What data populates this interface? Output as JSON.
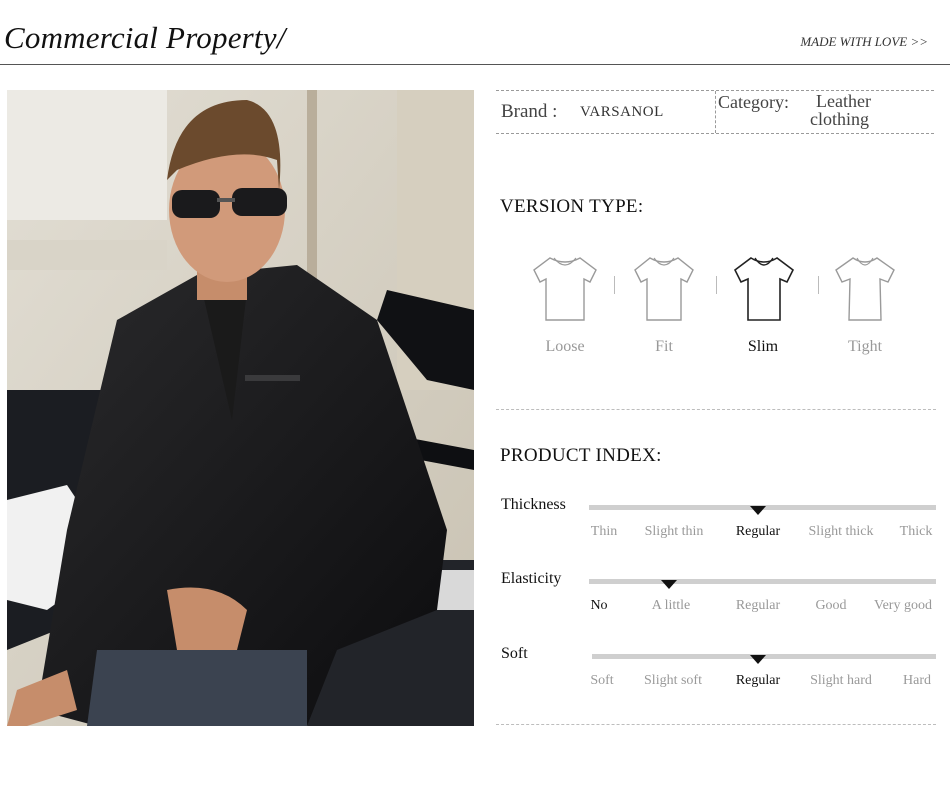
{
  "header": {
    "title": "Commercial Property/",
    "tagline": "MADE WITH LOVE >>"
  },
  "photo": {
    "alt": "model-photo"
  },
  "info": {
    "brand_label": "Brand :",
    "brand_value": "VARSANOL",
    "category_label": "Category:",
    "category_value_line1": "Leather",
    "category_value_line2": "clothing"
  },
  "version": {
    "heading": "VERSION TYPE:",
    "options": [
      {
        "label": "Loose",
        "selected": false
      },
      {
        "label": "Fit",
        "selected": false
      },
      {
        "label": "Slim",
        "selected": true
      },
      {
        "label": "Tight",
        "selected": false
      }
    ]
  },
  "product_index": {
    "heading": "PRODUCT INDEX:",
    "attributes": [
      {
        "name": "Thickness",
        "levels": [
          "Thin",
          "Slight thin",
          "Regular",
          "Slight thick",
          "Thick"
        ],
        "selected": 2,
        "selected_label": "Regular"
      },
      {
        "name": "Elasticity",
        "levels": [
          "No",
          "A little",
          "Regular",
          "Good",
          "Very good"
        ],
        "selected": 0,
        "selected_label": "No"
      },
      {
        "name": "Soft",
        "levels": [
          "Soft",
          "Slight soft",
          "Regular",
          "Slight hard",
          "Hard"
        ],
        "selected": 2,
        "selected_label": "Regular"
      }
    ]
  }
}
